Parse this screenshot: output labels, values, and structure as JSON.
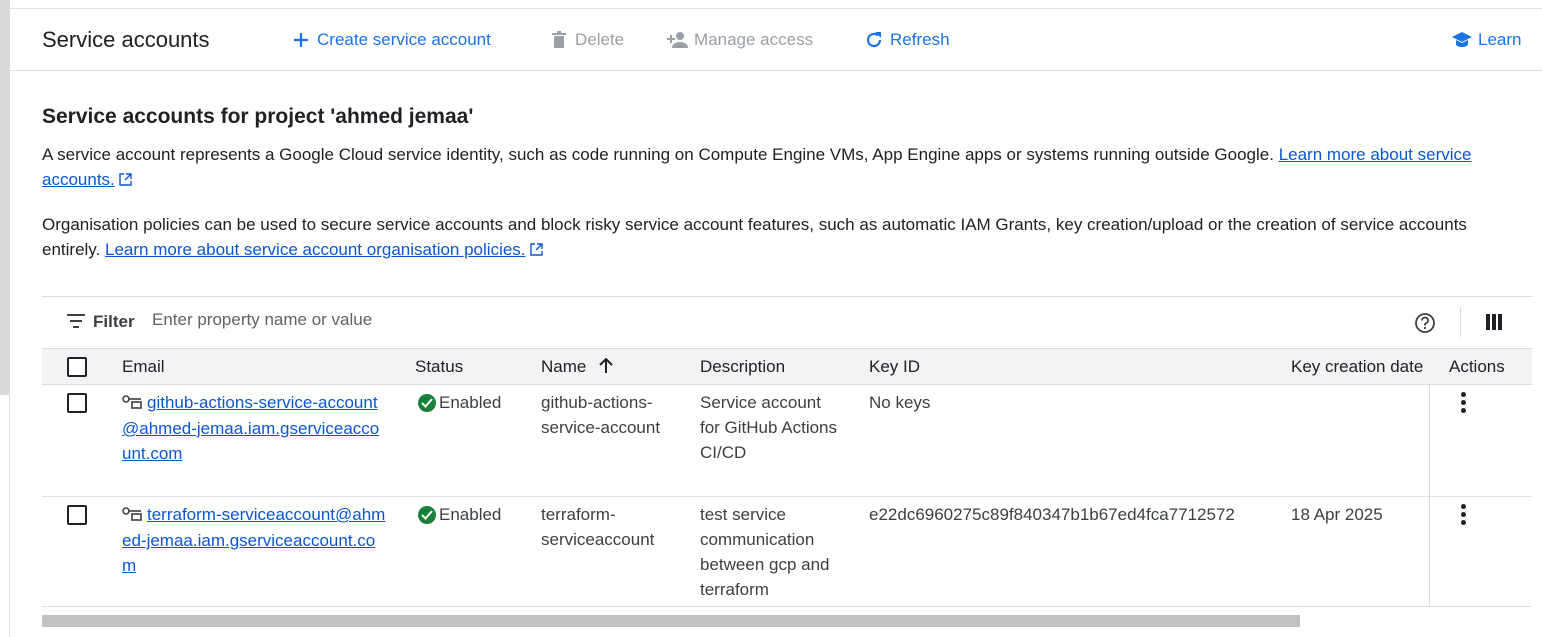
{
  "header": {
    "title": "Service accounts",
    "create_label": "Create service account",
    "delete_label": "Delete",
    "manage_access_label": "Manage access",
    "refresh_label": "Refresh",
    "learn_label": "Learn"
  },
  "intro": {
    "section_title": "Service accounts for project 'ahmed jemaa'",
    "para1_text": "A service account represents a Google Cloud service identity, such as code running on Compute Engine VMs, App Engine apps or systems running outside Google.",
    "para1_link": "Learn more about service accounts.",
    "para2_text": "Organisation policies can be used to secure service accounts and block risky service account features, such as automatic IAM Grants, key creation/upload or the creation of service accounts entirely.",
    "para2_link": "Learn more about service account organisation policies."
  },
  "filter": {
    "label": "Filter",
    "placeholder": "Enter property name or value"
  },
  "table": {
    "columns": {
      "email": "Email",
      "status": "Status",
      "name": "Name",
      "description": "Description",
      "key_id": "Key ID",
      "key_creation_date": "Key creation date",
      "actions": "Actions"
    },
    "rows": [
      {
        "email": "github-actions-service-account@ahmed-jemaa.iam.gserviceaccount.com",
        "status": "Enabled",
        "name": "github-actions-service-account",
        "description": "Service account for GitHub Actions CI/CD",
        "key_id": "No keys",
        "key_creation_date": ""
      },
      {
        "email": "terraform-serviceaccount@ahmed-jemaa.iam.gserviceaccount.com",
        "status": "Enabled",
        "name": "terraform-serviceaccount",
        "description": "test service communication between gcp and terraform",
        "key_id": "e22dc6960275c89f840347b1b67ed4fca7712572",
        "key_creation_date": "18 Apr 2025"
      }
    ]
  },
  "colors": {
    "accent": "#1a73e8",
    "link": "#0b57d0",
    "disabled": "#9aa0a6",
    "success": "#188038",
    "header_bg": "#f1f3f4"
  },
  "icons": {
    "create": "plus-icon",
    "delete": "trash-icon",
    "manage_access": "person-add-icon",
    "refresh": "refresh-icon",
    "learn": "school-icon",
    "filter": "filter-icon",
    "help": "help-icon",
    "columns": "columns-icon",
    "account": "key-account-icon",
    "status": "check-circle-icon",
    "actions": "more-vert-icon",
    "sort": "arrow-up-icon",
    "external": "open-in-new-icon"
  }
}
